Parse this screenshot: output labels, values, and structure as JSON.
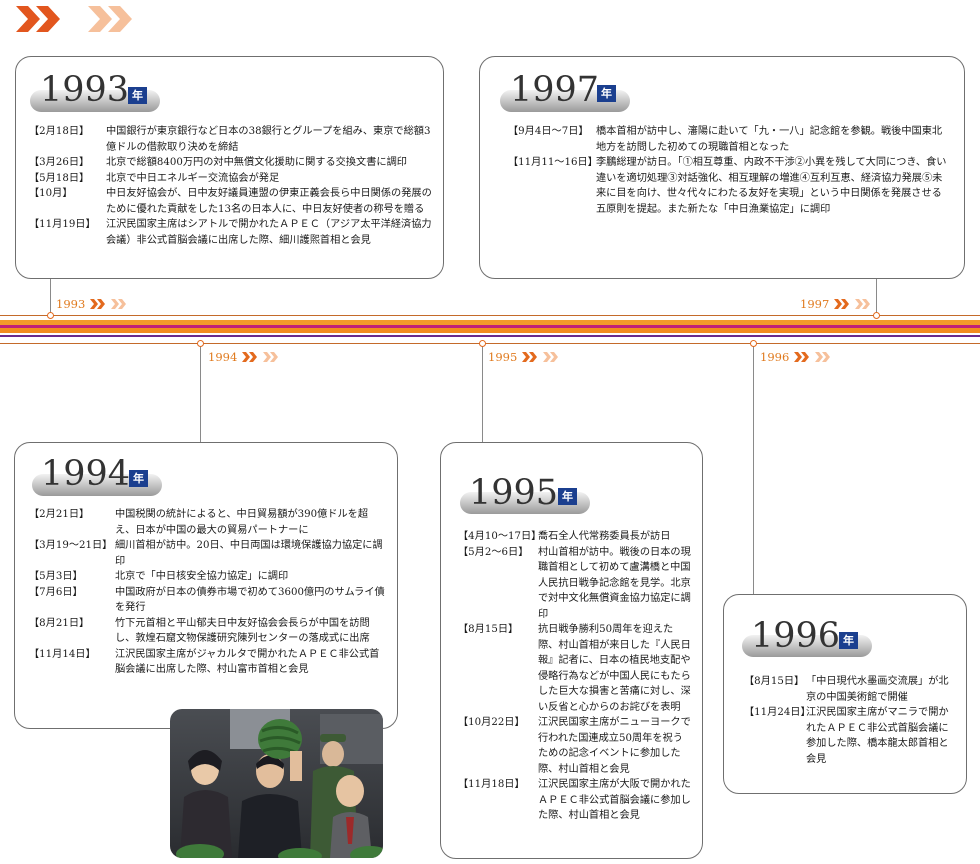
{
  "colors": {
    "accent_orange": "#e36a1e",
    "accent_light": "#f3b58b",
    "band_orange": "#f28c1e",
    "band_magenta": "#c0207a",
    "band_purple": "#6a2a8c",
    "year_badge": "#1b3f8f"
  },
  "header": {
    "icon": "double-chevron-right-icon"
  },
  "year_badge_char": "年",
  "markers": {
    "m1993": "1993",
    "m1994": "1994",
    "m1995": "1995",
    "m1996": "1996",
    "m1997": "1997"
  },
  "cards": {
    "y1993": {
      "year": "1993",
      "events": [
        {
          "date": "【2月18日】",
          "text": "中国銀行が東京銀行など日本の38銀行とグループを組み、東京で総額3億ドルの借款取り決めを締結"
        },
        {
          "date": "【3月26日】",
          "text": "北京で総額8400万円の対中無償文化援助に関する交換文書に調印"
        },
        {
          "date": "【5月18日】",
          "text": "北京で中日エネルギー交流協会が発足"
        },
        {
          "date": "【10月】",
          "text": "中日友好協会が、日中友好議員連盟の伊東正義会長ら中日関係の発展のために優れた貢献をした13名の日本人に、中日友好使者の称号を贈る"
        },
        {
          "date": "【11月19日】",
          "text": "江沢民国家主席はシアトルで開かれたＡＰＥＣ（アジア太平洋経済協力会議）非公式首脳会議に出席した際、細川護煕首相と会見"
        }
      ]
    },
    "y1997": {
      "year": "1997",
      "events": [
        {
          "date": "【9月4日～7日】",
          "text": "橋本首相が訪中し、瀋陽に赴いて「九・一八」記念館を参観。戦後中国東北地方を訪問した初めての現職首相となった"
        },
        {
          "date": "【11月11～16日】",
          "text": "李鵬総理が訪日。「①相互尊重、内政不干渉②小異を残して大同につき、食い違いを適切処理③対話強化、相互理解の増進④互利互恵、経済協力発展⑤未来に目を向け、世々代々にわたる友好を実現」という中日関係を発展させる五原則を提起。また新たな「中日漁業協定」に調印"
        }
      ]
    },
    "y1994": {
      "year": "1994",
      "events": [
        {
          "date": "【2月21日】",
          "text": "中国税関の統計によると、中日貿易額が390億ドルを超え、日本が中国の最大の貿易パートナーに"
        },
        {
          "date": "【3月19～21日】",
          "text": "細川首相が訪中。20日、中日両国は環境保護協力協定に調印"
        },
        {
          "date": "【5月3日】",
          "text": "北京で「中日核安全協力協定」に調印"
        },
        {
          "date": "【7月6日】",
          "text": "中国政府が日本の債券市場で初めて3600億円のサムライ債を発行"
        },
        {
          "date": "【8月21日】",
          "text": "竹下元首相と平山郁夫日中友好協会会長らが中国を訪問し、敦煌石窟文物保護研究陳列センターの落成式に出席"
        },
        {
          "date": "【11月14日】",
          "text": "江沢民国家主席がジャカルタで開かれたＡＰＥＣ非公式首脳会議に出席した際、村山富市首相と会見"
        }
      ]
    },
    "y1995": {
      "year": "1995",
      "events": [
        {
          "date": "【4月10～17日】",
          "text": "喬石全人代常務委員長が訪日"
        },
        {
          "date": "【5月2～6日】",
          "text": "村山首相が訪中。戦後の日本の現職首相として初めて盧溝橋と中国人民抗日戦争記念館を見学。北京で対中文化無償資金協力協定に調印"
        },
        {
          "date": "【8月15日】",
          "text": "抗日戦争勝利50周年を迎えた際、村山首相が来日した『人民日報』記者に、日本の植民地支配や侵略行為などが中国人民にもたらした巨大な損害と苦痛に対し、深い反省と心からのお詫びを表明"
        },
        {
          "date": "【10月22日】",
          "text": "江沢民国家主席がニューヨークで行われた国連成立50周年を祝うための記念イベントに参加した際、村山首相と会見"
        },
        {
          "date": "【11月18日】",
          "text": "江沢民国家主席が大阪で開かれたＡＰＥＣ非公式首脳会議に参加した際、村山首相と会見"
        }
      ]
    },
    "y1996": {
      "year": "1996",
      "events": [
        {
          "date": "【8月15日】",
          "text": "「中日現代水墨画交流展」が北京の中国美術館で開催"
        },
        {
          "date": "【11月24日】",
          "text": "江沢民国家主席がマニラで開かれたＡＰＥＣ非公式首脳会議に参加した際、橋本龍太郎首相と会見"
        }
      ]
    }
  }
}
